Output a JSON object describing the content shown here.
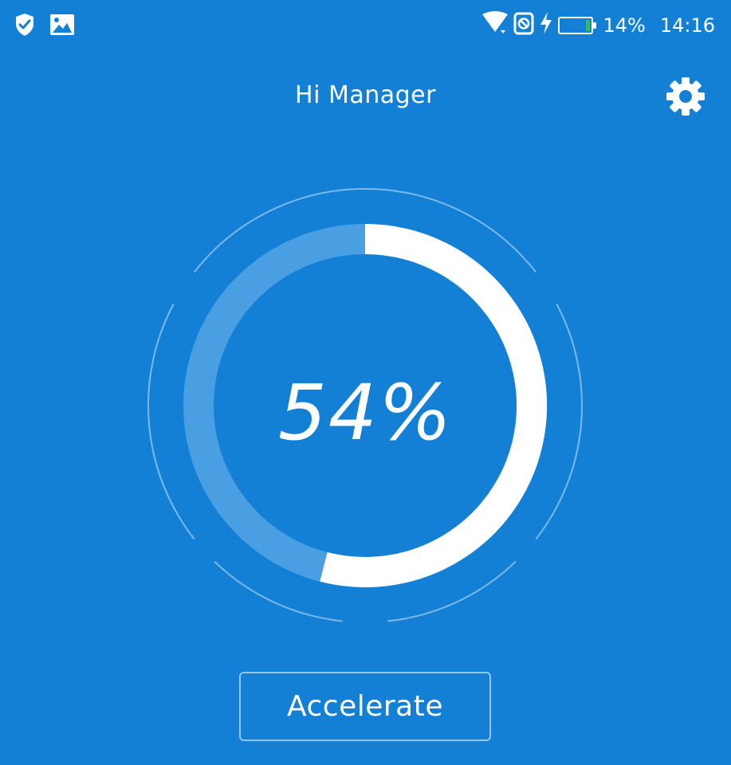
{
  "status_bar": {
    "left_icons": [
      "shield-check-icon",
      "image-icon"
    ],
    "right_icons": [
      "wifi-icon",
      "blocked-icon",
      "charging-bolt-icon",
      "battery-icon"
    ],
    "battery_text": "14%",
    "battery_level": 0.14,
    "time": "14:16",
    "battery_fill_color": "#2EC24B"
  },
  "header": {
    "title": "Hi Manager",
    "settings_icon": "gear-icon"
  },
  "gauge": {
    "value": 54,
    "label": "54%",
    "progress_color": "#FFFFFF",
    "track_color": "#4A9FE2"
  },
  "actions": {
    "accelerate_label": "Accelerate"
  },
  "colors": {
    "background": "#1380D6"
  }
}
